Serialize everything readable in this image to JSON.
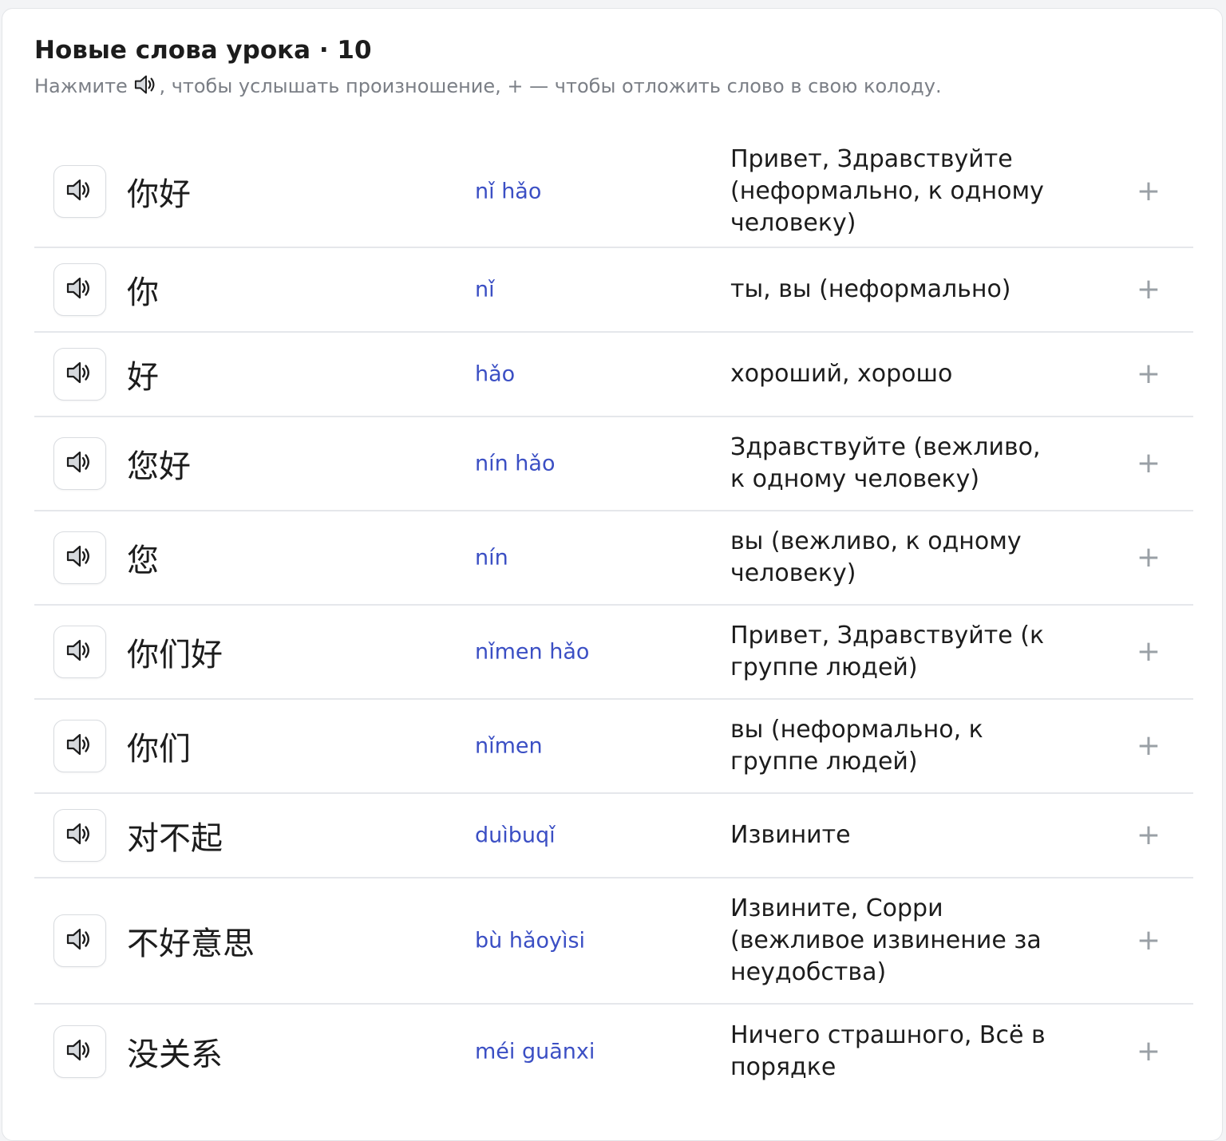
{
  "header": {
    "title": "Новые слова урока · 10",
    "subtitle_before": "Нажмите ",
    "subtitle_after": ", чтобы услышать произношение, + — чтобы отложить слово в свою колоду."
  },
  "icons": {
    "speaker": "speaker-icon",
    "add": "plus-icon"
  },
  "add_label": "+",
  "words": [
    {
      "hanzi": "你好",
      "pinyin": "nǐ hǎo",
      "meaning": "Привет, Здравствуйте (неформально, к одному человеку)"
    },
    {
      "hanzi": "你",
      "pinyin": "nǐ",
      "meaning": "ты, вы (неформально)"
    },
    {
      "hanzi": "好",
      "pinyin": "hǎo",
      "meaning": "хороший, хорошо"
    },
    {
      "hanzi": "您好",
      "pinyin": "nín hǎo",
      "meaning": "Здравствуйте (вежливо, к одному человеку)"
    },
    {
      "hanzi": "您",
      "pinyin": "nín",
      "meaning": "вы (вежливо, к одному человеку)"
    },
    {
      "hanzi": "你们好",
      "pinyin": "nǐmen hǎo",
      "meaning": "Привет, Здравствуйте (к группе людей)"
    },
    {
      "hanzi": "你们",
      "pinyin": "nǐmen",
      "meaning": "вы (неформально, к группе людей)"
    },
    {
      "hanzi": "对不起",
      "pinyin": "duìbuqǐ",
      "meaning": "Извините"
    },
    {
      "hanzi": "不好意思",
      "pinyin": "bù hǎoyìsi",
      "meaning": "Извините, Сорри (вежливое извинение за неудобства)"
    },
    {
      "hanzi": "没关系",
      "pinyin": "méi guānxi",
      "meaning": "Ничего страшного, Всё в порядке"
    }
  ]
}
